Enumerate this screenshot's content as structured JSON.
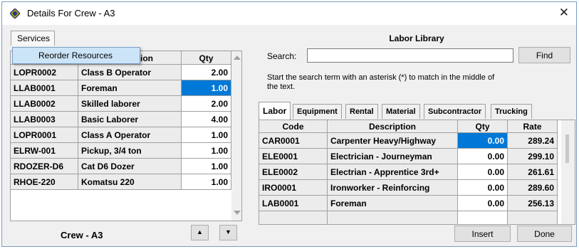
{
  "window": {
    "title": "Details For Crew - A3",
    "close_glyph": "✕",
    "icon": "app-diamond-icon"
  },
  "menu": {
    "services": "Services",
    "dropdown_item": "Reorder Resources"
  },
  "crew_grid": {
    "headers": {
      "code": "",
      "description": "Description",
      "qty": "Qty"
    },
    "rows": [
      {
        "code": "LOPR0002",
        "description": "Class B Operator",
        "qty": "2.00"
      },
      {
        "code": "LLAB0001",
        "description": "Foreman",
        "qty": "1.00",
        "selected": true
      },
      {
        "code": "LLAB0002",
        "description": "Skilled laborer",
        "qty": "2.00"
      },
      {
        "code": "LLAB0003",
        "description": "Basic Laborer",
        "qty": "4.00"
      },
      {
        "code": "LOPR0001",
        "description": "Class A Operator",
        "qty": "1.00"
      },
      {
        "code": "ELRW-001",
        "description": "Pickup, 3/4 ton",
        "qty": "1.00"
      },
      {
        "code": "RDOZER-D6",
        "description": "Cat D6 Dozer",
        "qty": "1.00"
      },
      {
        "code": "RHOE-220",
        "description": "Komatsu 220",
        "qty": "1.00"
      }
    ],
    "footer_label": "Crew - A3",
    "move_up": "▲",
    "move_down": "▼"
  },
  "library": {
    "title": "Labor Library",
    "search_label": "Search:",
    "search_value": "",
    "find_button": "Find",
    "hint": "Start the search term with an asterisk (*) to match in the middle of the text.",
    "tabs": [
      "Labor",
      "Equipment",
      "Rental",
      "Material",
      "Subcontractor",
      "Trucking"
    ],
    "active_tab": "Labor",
    "headers": {
      "code": "Code",
      "description": "Description",
      "qty": "Qty",
      "rate": "Rate"
    },
    "rows": [
      {
        "code": "CAR0001",
        "description": "Carpenter Heavy/Highway",
        "qty": "0.00",
        "rate": "289.24",
        "selected": true
      },
      {
        "code": "ELE0001",
        "description": "Electrician - Journeyman",
        "qty": "0.00",
        "rate": "299.10"
      },
      {
        "code": "ELE0002",
        "description": "Electrian - Apprentice 3rd+",
        "qty": "0.00",
        "rate": "261.61"
      },
      {
        "code": "IRO0001",
        "description": "Ironworker - Reinforcing",
        "qty": "0.00",
        "rate": "289.60"
      },
      {
        "code": "LAB0001",
        "description": "Foreman",
        "qty": "0.00",
        "rate": "256.13"
      }
    ],
    "insert_button": "Insert",
    "done_button": "Done"
  },
  "colors": {
    "selection": "#0078d7",
    "grid_bg": "#ececec",
    "window_bg": "#f0f0f0"
  }
}
